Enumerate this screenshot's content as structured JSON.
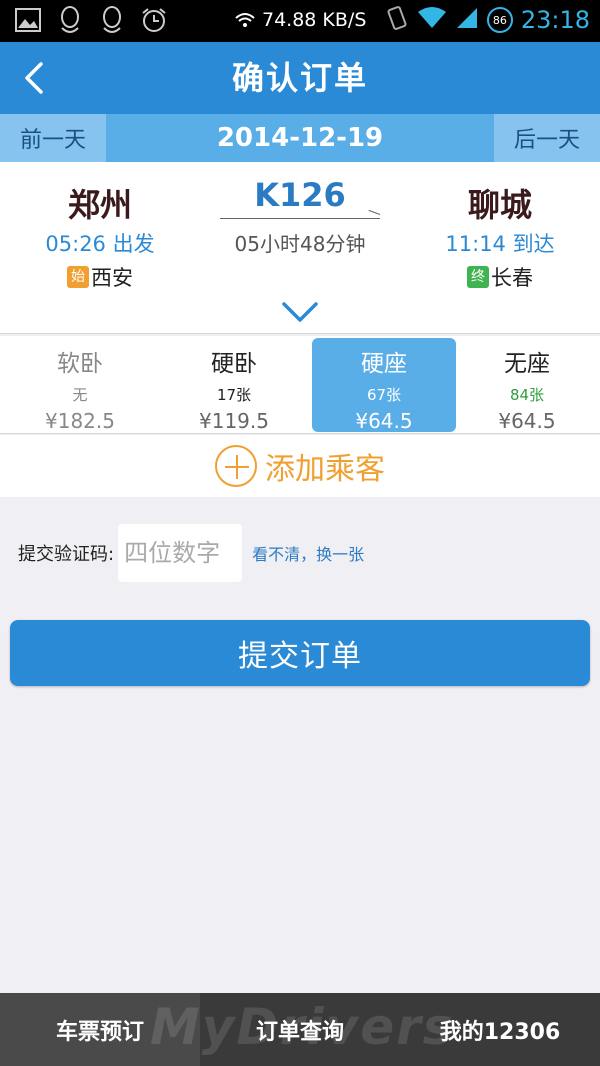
{
  "status_bar": {
    "net_speed": "74.88 KB/S",
    "battery": "86",
    "time": "23:18"
  },
  "header": {
    "title": "确认订单"
  },
  "date_bar": {
    "prev_label": "前一天",
    "date": "2014-12-19",
    "next_label": "后一天"
  },
  "train": {
    "number": "K126",
    "duration": "05小时48分钟",
    "from": {
      "station": "郑州",
      "time_label": "05:26 出发",
      "tag": "始",
      "origin": "西安"
    },
    "to": {
      "station": "聊城",
      "time_label": "11:14 到达",
      "tag": "终",
      "terminal": "长春"
    }
  },
  "seats": [
    {
      "name": "软卧",
      "count": "无",
      "price": "¥182.5",
      "state": "disabled"
    },
    {
      "name": "硬卧",
      "count": "17张",
      "price": "¥119.5",
      "state": "normal"
    },
    {
      "name": "硬座",
      "count": "67张",
      "price": "¥64.5",
      "state": "selected"
    },
    {
      "name": "无座",
      "count": "84张",
      "price": "¥64.5",
      "state": "green"
    }
  ],
  "add_passenger": {
    "label": "添加乘客"
  },
  "captcha": {
    "label": "提交验证码:",
    "placeholder": "四位数字",
    "refresh_label": "看不清，换一张"
  },
  "submit": {
    "label": "提交订单"
  },
  "bottom_nav": {
    "items": [
      {
        "label": "车票预订",
        "active": true
      },
      {
        "label": "订单查询",
        "active": false
      },
      {
        "label": "我的12306",
        "active": false
      }
    ]
  },
  "watermark": "MyDrivers",
  "colors": {
    "primary": "#2b8ad6",
    "accent": "#f0a030",
    "green": "#3fb34f"
  }
}
